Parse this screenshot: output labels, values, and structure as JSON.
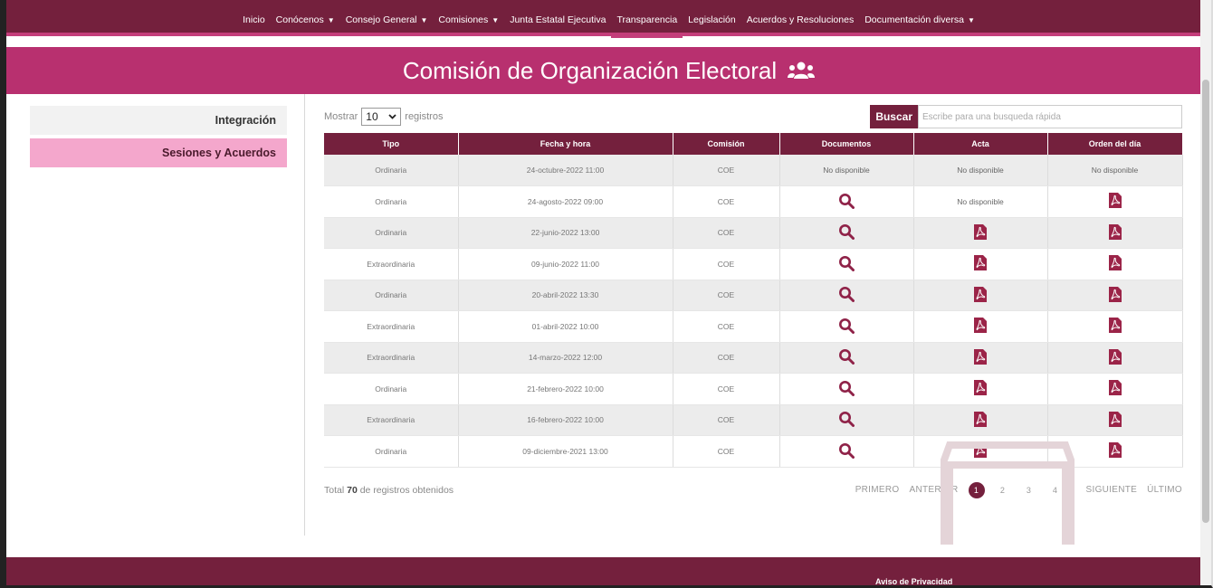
{
  "nav": {
    "items": [
      {
        "label": "Inicio",
        "caret": false
      },
      {
        "label": "Conócenos",
        "caret": true
      },
      {
        "label": "Consejo General",
        "caret": true
      },
      {
        "label": "Comisiones",
        "caret": true
      },
      {
        "label": "Junta Estatal Ejecutiva",
        "caret": false
      },
      {
        "label": "Transparencia",
        "caret": false
      },
      {
        "label": "Legislación",
        "caret": false
      },
      {
        "label": "Acuerdos y Resoluciones",
        "caret": false
      },
      {
        "label": "Documentación diversa",
        "caret": true
      }
    ],
    "active_index": 5
  },
  "banner": {
    "title": "Comisión de Organización Electoral",
    "icon": "users-icon"
  },
  "sidebar": {
    "items": [
      "Integración",
      "Sesiones y Acuerdos"
    ],
    "active_index": 1
  },
  "controls": {
    "show_label": "Mostrar",
    "show_value": "10",
    "records_label": "registros",
    "search_button": "Buscar",
    "search_placeholder": "Escribe para una busqueda rápida"
  },
  "table": {
    "headers": [
      "Tipo",
      "Fecha y hora",
      "Comisión",
      "Documentos",
      "Acta",
      "Orden del día"
    ],
    "rows": [
      {
        "tipo": "Ordinaria",
        "fecha": "24-octubre-2022 11:00",
        "comision": "COE",
        "documentos": "No disponible",
        "acta": "No disponible",
        "orden": "No disponible"
      },
      {
        "tipo": "Ordinaria",
        "fecha": "24-agosto-2022 09:00",
        "comision": "COE",
        "documentos": "search",
        "acta": "No disponible",
        "orden": "pdf"
      },
      {
        "tipo": "Ordinaria",
        "fecha": "22-junio-2022 13:00",
        "comision": "COE",
        "documentos": "search",
        "acta": "pdf",
        "orden": "pdf"
      },
      {
        "tipo": "Extraordinaria",
        "fecha": "09-junio-2022 11:00",
        "comision": "COE",
        "documentos": "search",
        "acta": "pdf",
        "orden": "pdf"
      },
      {
        "tipo": "Ordinaria",
        "fecha": "20-abril-2022 13:30",
        "comision": "COE",
        "documentos": "search",
        "acta": "pdf",
        "orden": "pdf"
      },
      {
        "tipo": "Extraordinaria",
        "fecha": "01-abril-2022 10:00",
        "comision": "COE",
        "documentos": "search",
        "acta": "pdf",
        "orden": "pdf"
      },
      {
        "tipo": "Extraordinaria",
        "fecha": "14-marzo-2022 12:00",
        "comision": "COE",
        "documentos": "search",
        "acta": "pdf",
        "orden": "pdf"
      },
      {
        "tipo": "Ordinaria",
        "fecha": "21-febrero-2022 10:00",
        "comision": "COE",
        "documentos": "search",
        "acta": "pdf",
        "orden": "pdf"
      },
      {
        "tipo": "Extraordinaria",
        "fecha": "16-febrero-2022 10:00",
        "comision": "COE",
        "documentos": "search",
        "acta": "pdf",
        "orden": "pdf"
      },
      {
        "tipo": "Ordinaria",
        "fecha": "09-diciembre-2021 13:00",
        "comision": "COE",
        "documentos": "search",
        "acta": "pdf",
        "orden": "pdf"
      }
    ]
  },
  "summary": {
    "prefix": "Total",
    "count": "70",
    "suffix": "de registros obtenidos"
  },
  "pagination": {
    "first": "PRIMERO",
    "prev": "ANTERIOR",
    "pages": [
      "1",
      "2",
      "3",
      "4"
    ],
    "current": "1",
    "next": "SIGUIENTE",
    "last": "ÚLTIMO"
  },
  "footer": {
    "privacy": "Aviso de Privacidad"
  },
  "colors": {
    "primary": "#74203d",
    "accent": "#b8306f",
    "sidebar_active": "#f4a7cc",
    "icon": "#8f2248"
  }
}
